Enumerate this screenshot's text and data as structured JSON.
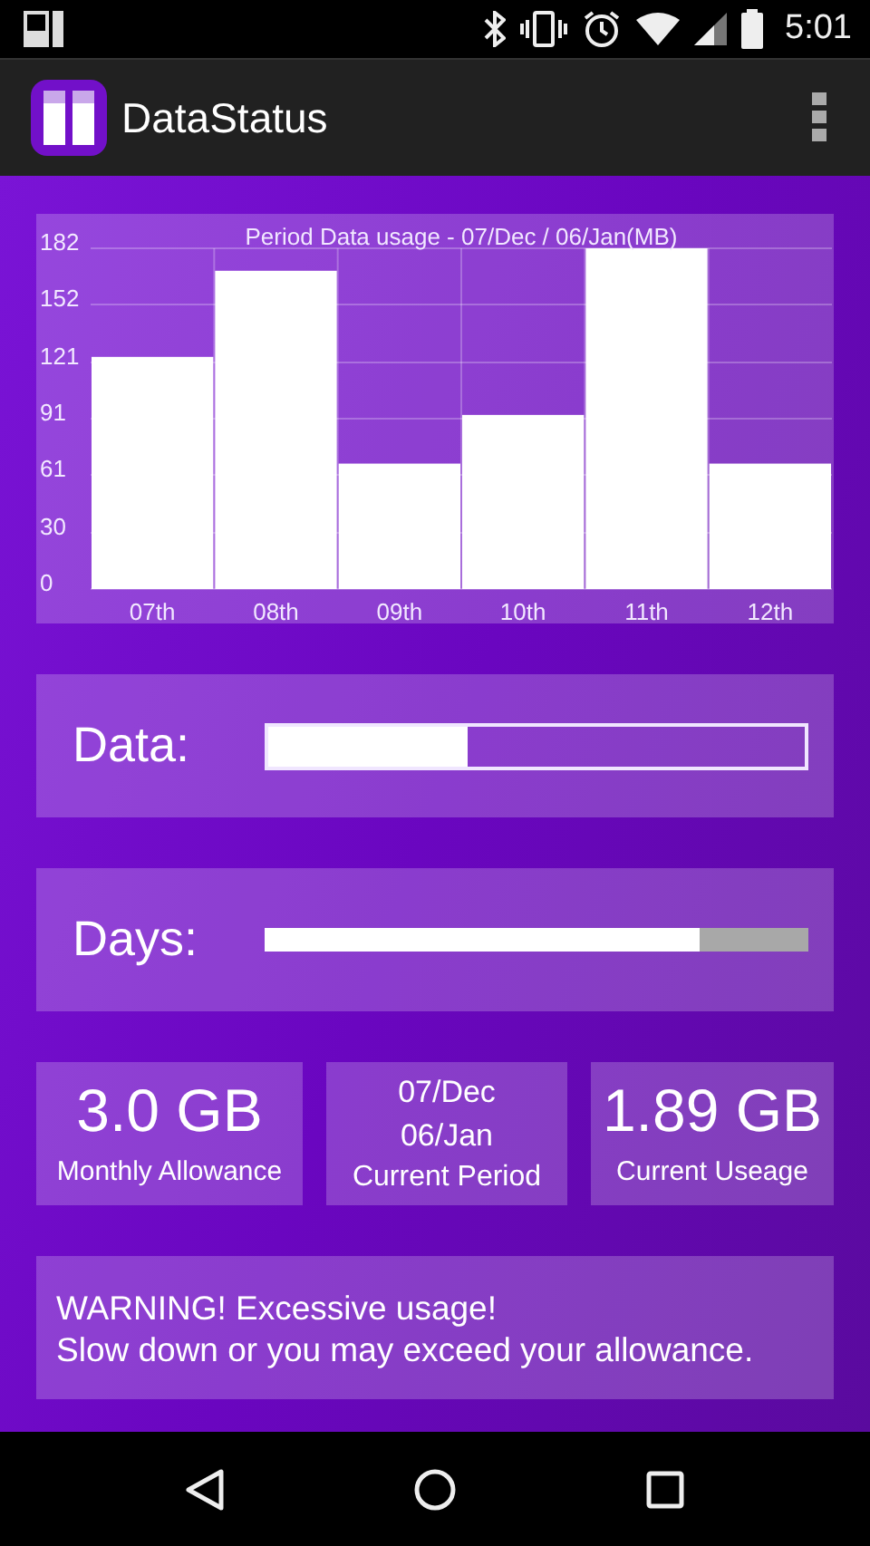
{
  "status_bar": {
    "time": "5:01"
  },
  "app_bar": {
    "title": "DataStatus"
  },
  "chart": {
    "chart_data": {
      "type": "bar",
      "title": "Period Data usage - 07/Dec / 06/Jan(MB)",
      "categories": [
        "07th",
        "08th",
        "09th",
        "10th",
        "11th",
        "12th"
      ],
      "values": [
        124,
        170,
        67,
        93,
        182,
        67
      ],
      "ylim": [
        0,
        182
      ],
      "grid": true,
      "yticks": [
        0,
        30,
        61,
        91,
        121,
        152,
        182
      ]
    }
  },
  "meters": [
    {
      "kind": "outlined",
      "label": "Data:",
      "level": 0.37
    },
    {
      "kind": "solid",
      "label": "Days:",
      "level": 0.8
    }
  ],
  "stats": [
    {
      "kind": "amount",
      "value": "3.0 GB",
      "caption": "Monthly Allowance"
    },
    {
      "kind": "period",
      "start": "07/Dec",
      "end": "06/Jan",
      "caption": "Current Period"
    },
    {
      "kind": "amount",
      "value": "1.89 GB",
      "caption": "Current Useage"
    }
  ],
  "warning": {
    "lines": [
      "WARNING! Excessive usage!",
      "Slow down or you may exceed your allowance."
    ]
  }
}
